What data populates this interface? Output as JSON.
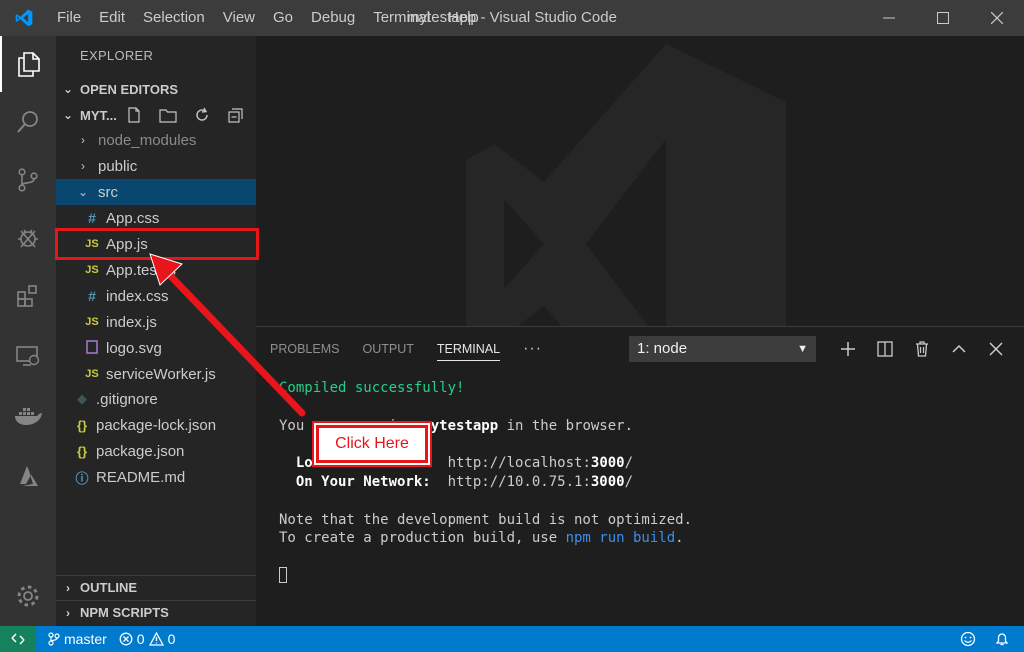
{
  "titlebar": {
    "window_title": "mytestapp - Visual Studio Code",
    "menu": [
      "File",
      "Edit",
      "Selection",
      "View",
      "Go",
      "Debug",
      "Terminal",
      "Help"
    ]
  },
  "sidebar": {
    "title": "EXPLORER",
    "open_editors_label": "OPEN EDITORS",
    "project_label": "MYT...",
    "tree": [
      {
        "label": "node_modules",
        "kind": "folder",
        "expanded": false
      },
      {
        "label": "public",
        "kind": "folder",
        "expanded": false
      },
      {
        "label": "src",
        "kind": "folder",
        "expanded": true
      },
      {
        "label": "App.css",
        "kind": "css"
      },
      {
        "label": "App.js",
        "kind": "js"
      },
      {
        "label": "App.test.js",
        "kind": "js"
      },
      {
        "label": "index.css",
        "kind": "css"
      },
      {
        "label": "index.js",
        "kind": "js"
      },
      {
        "label": "logo.svg",
        "kind": "svg"
      },
      {
        "label": "serviceWorker.js",
        "kind": "js"
      },
      {
        "label": ".gitignore",
        "kind": "git"
      },
      {
        "label": "package-lock.json",
        "kind": "json"
      },
      {
        "label": "package.json",
        "kind": "json"
      },
      {
        "label": "README.md",
        "kind": "info"
      }
    ],
    "outline_label": "OUTLINE",
    "npm_scripts_label": "NPM SCRIPTS"
  },
  "panel": {
    "tabs": [
      "PROBLEMS",
      "OUTPUT",
      "TERMINAL"
    ],
    "active_tab": "TERMINAL",
    "more_label": "···",
    "terminal_select": "1: node",
    "terminal": {
      "compiled": "Compiled successfully!",
      "line_view_prefix": "You can now view ",
      "app_name": "mytestapp",
      "line_view_suffix": " in the browser.",
      "local_label": "Local:",
      "local_url_prefix": "http://localhost:",
      "port": "3000",
      "network_label": "On Your Network:",
      "network_url_prefix": "http://10.0.75.1:",
      "note_line": "Note that the development build is not optimized.",
      "build_prefix": "To create a production build, use ",
      "build_cmd": "npm run build",
      "build_suffix": "."
    }
  },
  "statusbar": {
    "branch": "master",
    "errors": "0",
    "warnings": "0"
  },
  "annotation": {
    "callout": "Click Here",
    "color": "#e8151b"
  }
}
